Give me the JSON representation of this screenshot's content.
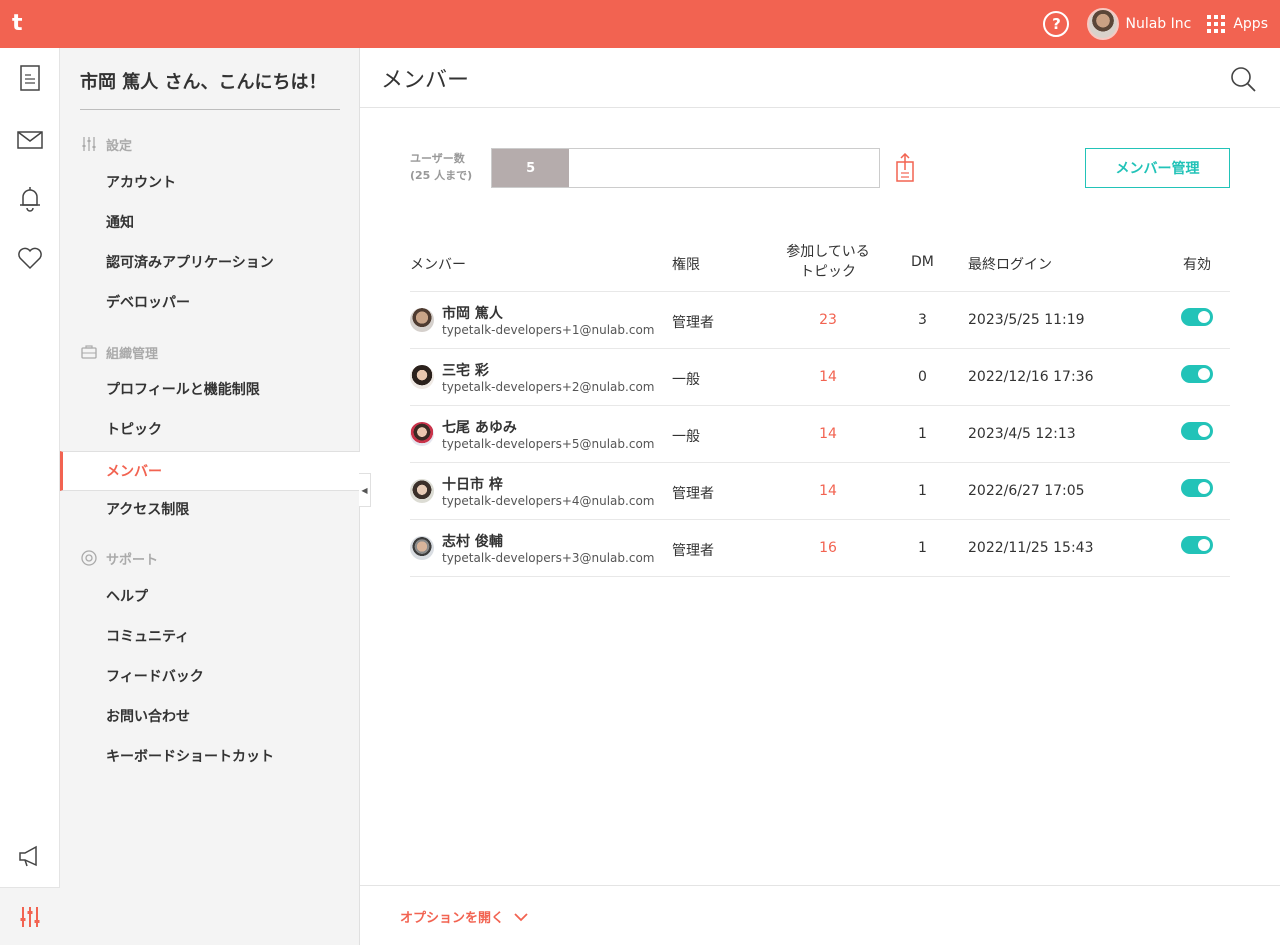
{
  "topbar": {
    "logo": "t",
    "help": "?",
    "org_name": "Nulab Inc",
    "apps_label": "Apps"
  },
  "nav": {
    "greeting": "市岡 篤人 さん、こんにちは！",
    "sections": [
      {
        "title": "設定",
        "icon": "sliders-icon",
        "items": [
          "アカウント",
          "通知",
          "認可済みアプリケーション",
          "デベロッパー"
        ]
      },
      {
        "title": "組織管理",
        "icon": "briefcase-icon",
        "items": [
          "プロフィールと機能制限",
          "トピック",
          "メンバー",
          "アクセス制限"
        ]
      },
      {
        "title": "サポート",
        "icon": "lifebuoy-icon",
        "items": [
          "ヘルプ",
          "コミュニティ",
          "フィードバック",
          "お問い合わせ",
          "キーボードショートカット"
        ]
      }
    ],
    "active_item": "メンバー"
  },
  "main": {
    "title": "メンバー",
    "usercount": {
      "label_line1": "ユーザー数",
      "label_line2": "(25 人まで)",
      "count": "5",
      "max": 25
    },
    "manage_button": "メンバー管理",
    "table": {
      "headers": {
        "member": "メンバー",
        "role": "権限",
        "topics_line1": "参加している",
        "topics_line2": "トピック",
        "dm": "DM",
        "last_login": "最終ログイン",
        "enabled": "有効"
      },
      "rows": [
        {
          "name": "市岡 篤人",
          "email": "typetalk-developers+1@nulab.com",
          "role": "管理者",
          "topics": "23",
          "dm": "3",
          "last_login": "2023/5/25 11:19",
          "enabled": true
        },
        {
          "name": "三宅 彩",
          "email": "typetalk-developers+2@nulab.com",
          "role": "一般",
          "topics": "14",
          "dm": "0",
          "last_login": "2022/12/16 17:36",
          "enabled": true
        },
        {
          "name": "七尾 あゆみ",
          "email": "typetalk-developers+5@nulab.com",
          "role": "一般",
          "topics": "14",
          "dm": "1",
          "last_login": "2023/4/5 12:13",
          "enabled": true
        },
        {
          "name": "十日市 梓",
          "email": "typetalk-developers+4@nulab.com",
          "role": "管理者",
          "topics": "14",
          "dm": "1",
          "last_login": "2022/6/27 17:05",
          "enabled": true
        },
        {
          "name": "志村 俊輔",
          "email": "typetalk-developers+3@nulab.com",
          "role": "管理者",
          "topics": "16",
          "dm": "1",
          "last_login": "2022/11/25 15:43",
          "enabled": true
        }
      ]
    }
  },
  "footer": {
    "options_label": "オプションを開く"
  },
  "colors": {
    "brand": "#f26351",
    "accent": "#22c3b8",
    "bar_fill": "#b5acac"
  }
}
